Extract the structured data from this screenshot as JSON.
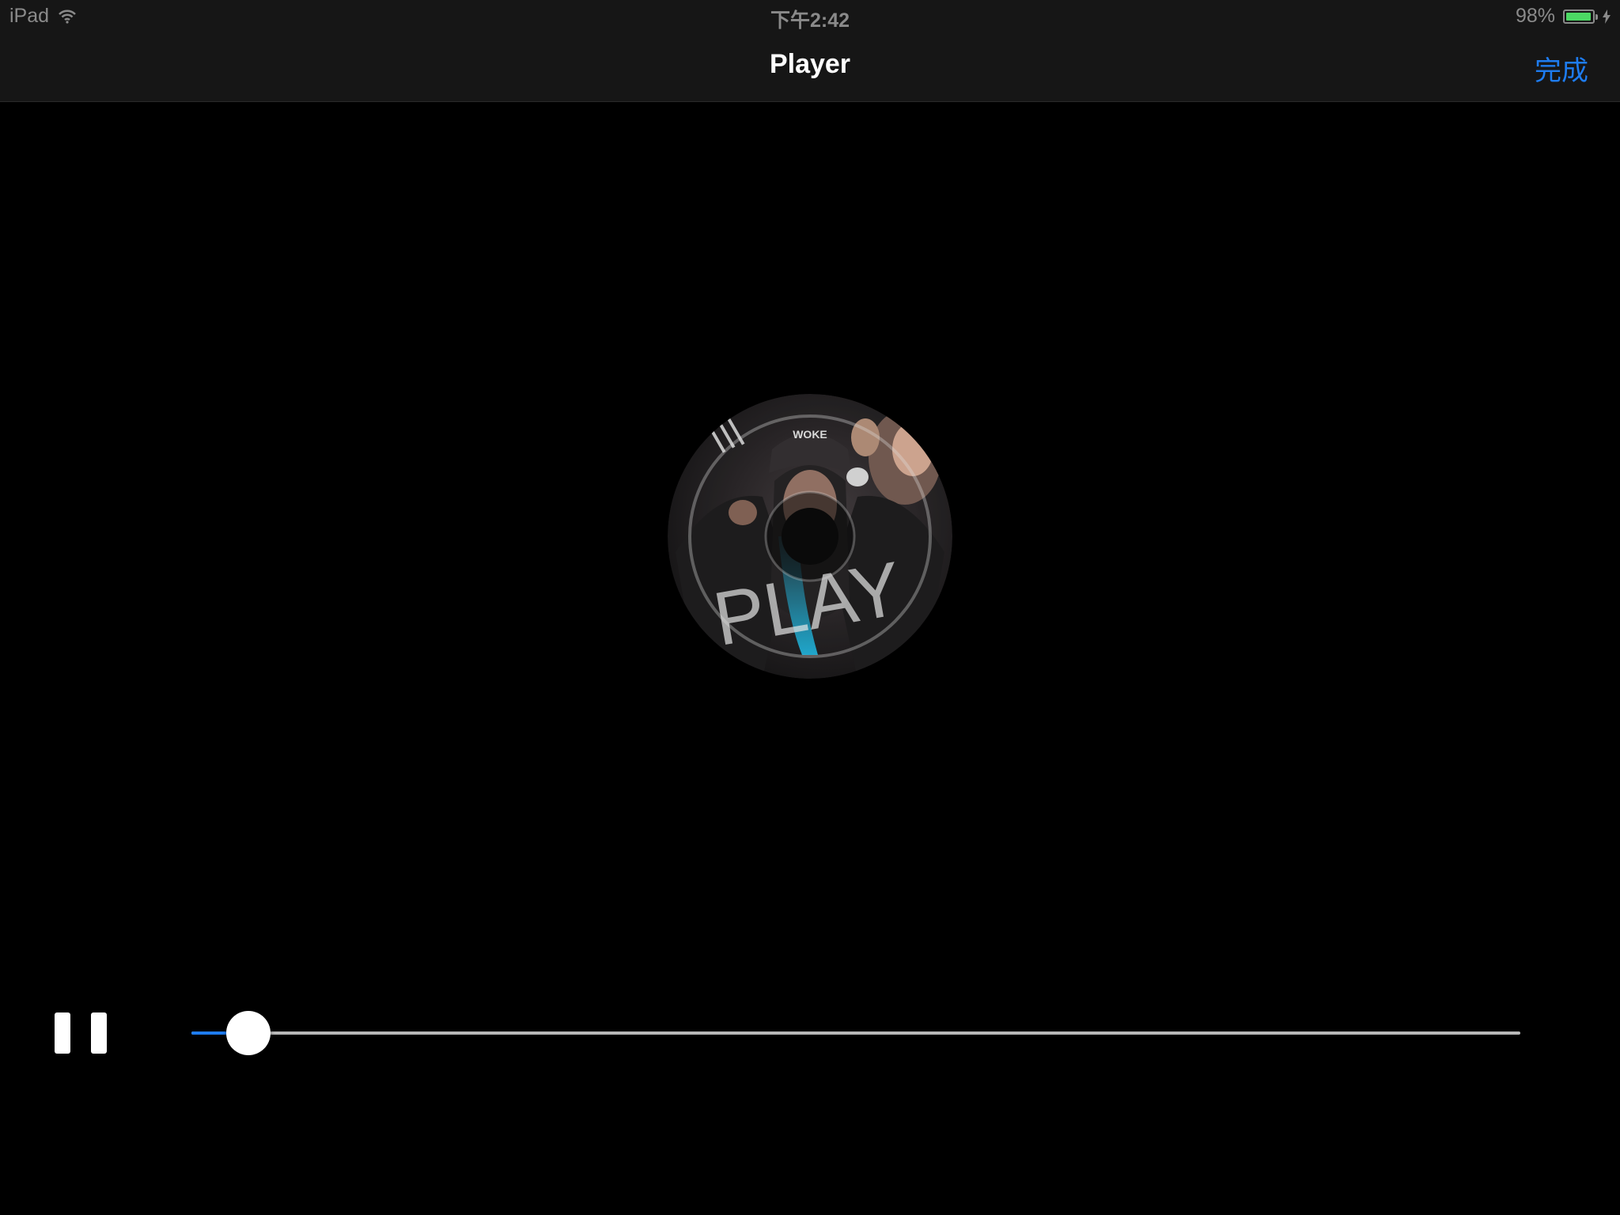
{
  "status_bar": {
    "device": "iPad",
    "time": "下午2:42",
    "battery_text": "98%",
    "battery_level": 0.98,
    "battery_color": "#4cd964",
    "icons": [
      "wifi-icon",
      "battery-icon",
      "charging-bolt-icon"
    ]
  },
  "nav": {
    "title": "Player",
    "done_label": "完成",
    "accent_color": "#1e7cf0"
  },
  "album": {
    "cover_text": "PLAY",
    "cap_text": "WOKE"
  },
  "controls": {
    "play_state_icon": "pause-icon",
    "progress": 0.043
  }
}
